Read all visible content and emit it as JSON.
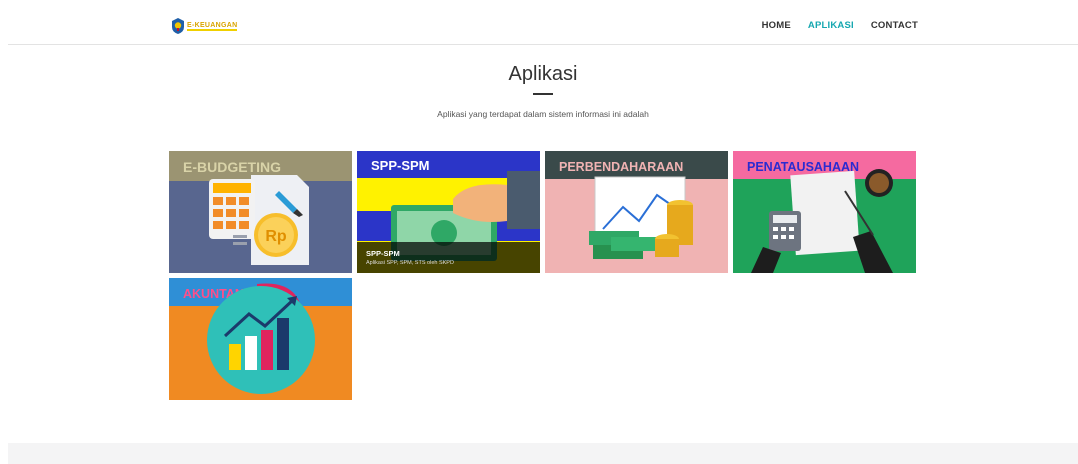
{
  "brand": {
    "text": "E-KEUANGAN"
  },
  "nav": {
    "items": [
      {
        "label": "HOME"
      },
      {
        "label": "APLIKASI"
      },
      {
        "label": "CONTACT"
      }
    ]
  },
  "page": {
    "title": "Aplikasi",
    "subtitle": "Aplikasi yang terdapat dalam sistem informasi ini adalah"
  },
  "tiles": [
    {
      "label": "E-BUDGETING",
      "badge": "Rp"
    },
    {
      "label": "SPP-SPM",
      "caption_title": "SPP-SPM",
      "caption_desc": "Aplikasi SPP, SPM, STS oleh SKPD"
    },
    {
      "label": "PERBENDAHARAAN"
    },
    {
      "label": "PENATAUSAHAAN"
    },
    {
      "label": "AKUNTANSI"
    }
  ],
  "colors": {
    "accent": "#16a7b0",
    "footer": "#f4f4f5"
  }
}
